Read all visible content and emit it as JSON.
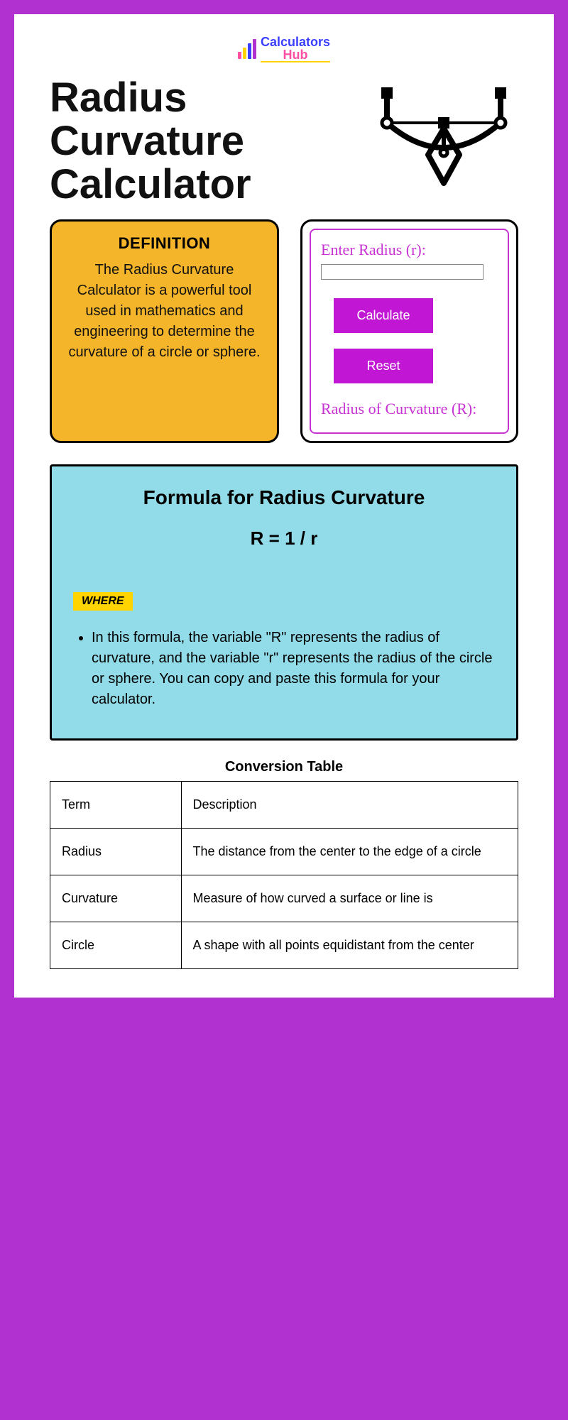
{
  "logo": {
    "line1": "Calculators",
    "line2": "Hub"
  },
  "title": "Radius Curvature Calculator",
  "definition": {
    "heading": "DEFINITION",
    "body": "The Radius Curvature Calculator is a powerful tool used in mathematics and engineering to determine the curvature of a circle or sphere."
  },
  "calculator": {
    "input_label": "Enter Radius (r):",
    "calculate_btn": "Calculate",
    "reset_btn": "Reset",
    "output_label": "Radius of Curvature (R):"
  },
  "formula": {
    "heading": "Formula for Radius Curvature",
    "equation": "R = 1 / r",
    "where_tag": "WHERE",
    "description": "In this formula, the variable \"R\" represents the radius of curvature, and the variable \"r\" represents the radius of the circle or sphere. You can copy and paste this formula for your calculator."
  },
  "table": {
    "title": "Conversion Table",
    "header": {
      "term": "Term",
      "desc": "Description"
    },
    "rows": [
      {
        "term": "Radius",
        "desc": "The distance from the center to the edge of a circle"
      },
      {
        "term": "Curvature",
        "desc": "Measure of how curved a surface or line is"
      },
      {
        "term": "Circle",
        "desc": "A shape with all points equidistant from the center"
      }
    ]
  }
}
